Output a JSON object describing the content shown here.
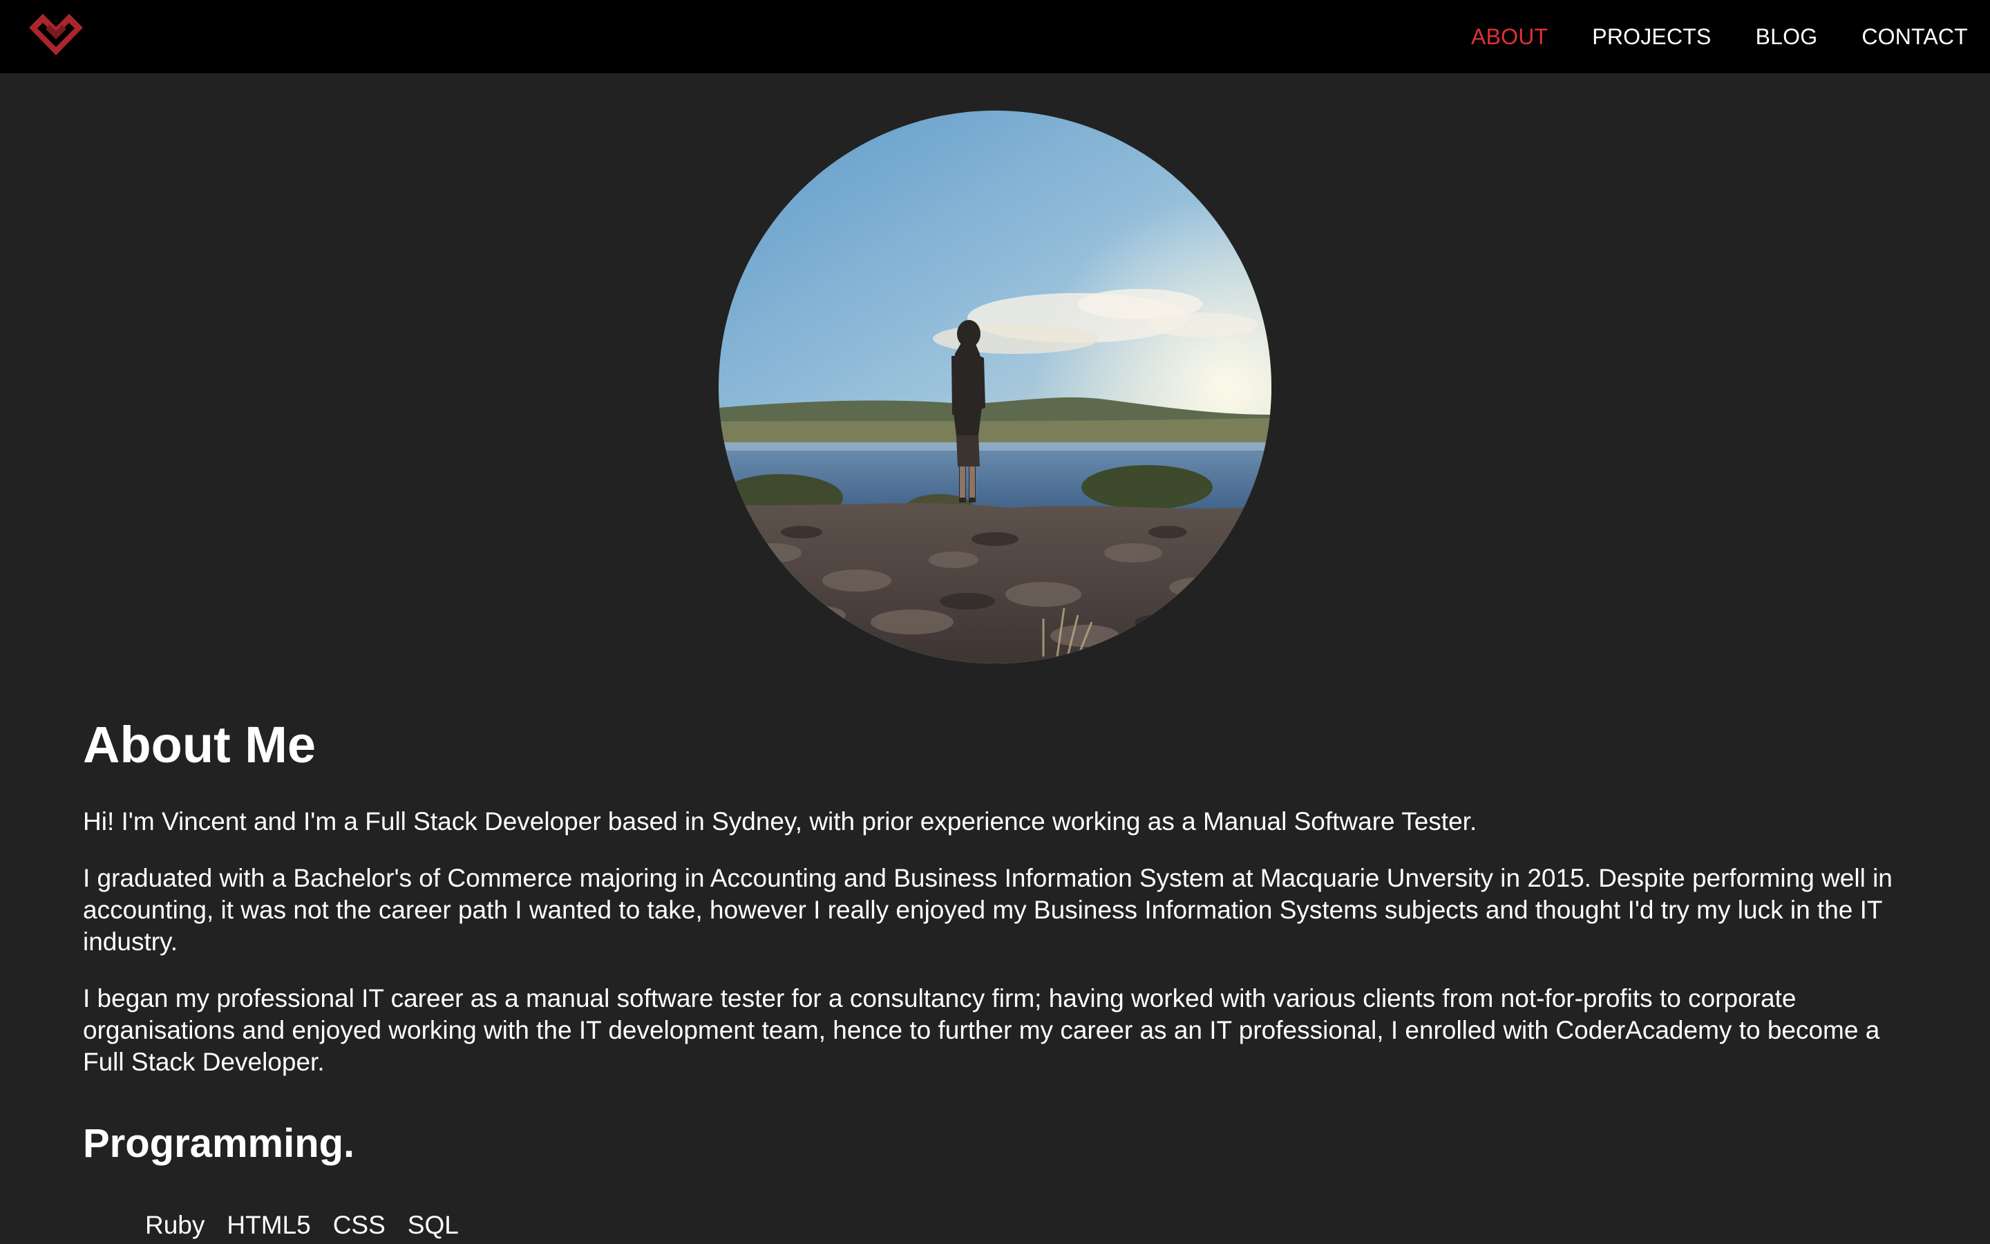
{
  "nav": {
    "logo_icon": "v-chevron-logo-icon",
    "accent_color": "#e0303a",
    "items": [
      {
        "label": "ABOUT",
        "active": true
      },
      {
        "label": "PROJECTS",
        "active": false
      },
      {
        "label": "BLOG",
        "active": false
      },
      {
        "label": "CONTACT",
        "active": false
      }
    ]
  },
  "about": {
    "title": "About Me",
    "paragraphs": [
      "Hi! I'm Vincent and I'm a Full Stack Developer based in Sydney, with prior experience working as a Manual Software Tester.",
      "I graduated with a Bachelor's of Commerce majoring in Accounting and Business Information System at Macquarie Unversity in 2015. Despite performing well in accounting, it was not the career path I wanted to take, however I really enjoyed my Business Information Systems subjects and thought I'd try my luck in the IT industry.",
      "I began my professional IT career as a manual software tester for a consultancy firm; having worked with various clients from not-for-profits to corporate organisations and enjoyed working with the IT development team, hence to further my career as an IT professional, I enrolled with CoderAcademy to become a Full Stack Developer."
    ]
  },
  "programming": {
    "title": "Programming.",
    "skills": [
      "Ruby",
      "HTML5",
      "CSS",
      "SQL"
    ]
  }
}
